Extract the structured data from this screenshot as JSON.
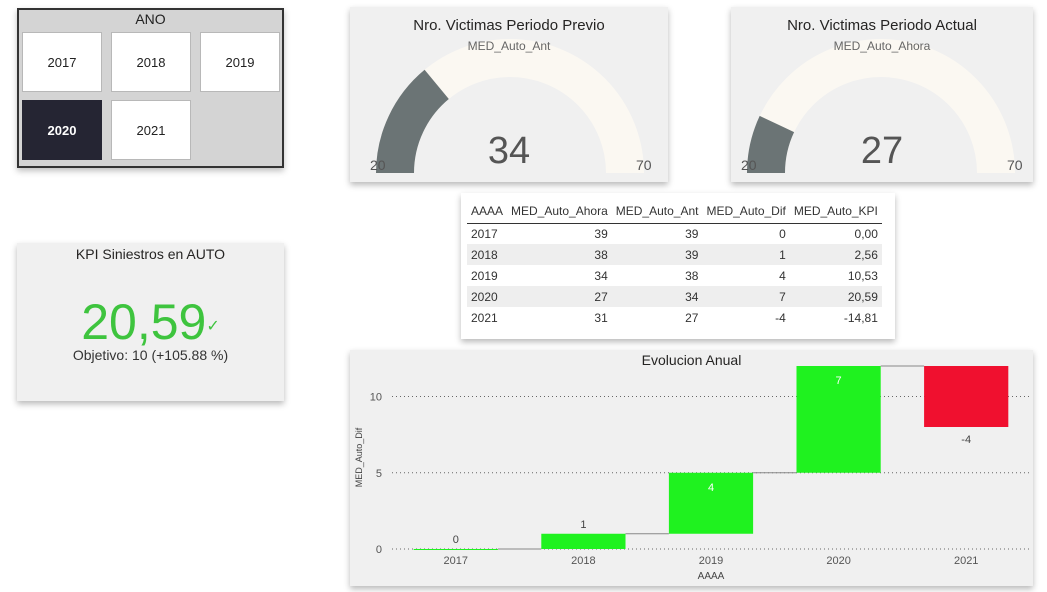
{
  "slicer": {
    "title": "ANO",
    "items": [
      {
        "label": "2017",
        "selected": false
      },
      {
        "label": "2018",
        "selected": false
      },
      {
        "label": "2019",
        "selected": false
      },
      {
        "label": "2020",
        "selected": true
      },
      {
        "label": "2021",
        "selected": false
      }
    ]
  },
  "gauge_prev": {
    "title": "Nro. Victimas Periodo Previo",
    "subtitle": "MED_Auto_Ant",
    "min": 20,
    "max": 70,
    "value": 34,
    "min_label": "20",
    "max_label": "70",
    "value_label": "34"
  },
  "gauge_curr": {
    "title": "Nro. Victimas Periodo Actual",
    "subtitle": "MED_Auto_Ahora",
    "min": 20,
    "max": 70,
    "value": 27,
    "min_label": "20",
    "max_label": "70",
    "value_label": "27"
  },
  "colors": {
    "gauge_fill": "#6b7475",
    "gauge_track": "#fbf8f2",
    "increase": "#1ff21f",
    "decrease": "#f0102f",
    "kpi_good": "#3ec43e",
    "slicer_selected": "#252533"
  },
  "table": {
    "headers": [
      "AAAA",
      "MED_Auto_Ahora",
      "MED_Auto_Ant",
      "MED_Auto_Dif",
      "MED_Auto_KPI"
    ],
    "rows": [
      [
        "2017",
        "39",
        "39",
        "0",
        "0,00"
      ],
      [
        "2018",
        "38",
        "39",
        "1",
        "2,56"
      ],
      [
        "2019",
        "34",
        "38",
        "4",
        "10,53"
      ],
      [
        "2020",
        "27",
        "34",
        "7",
        "20,59"
      ],
      [
        "2021",
        "31",
        "27",
        "-4",
        "-14,81"
      ]
    ]
  },
  "kpi": {
    "title": "KPI Siniestros en AUTO",
    "value": "20,59",
    "check_icon": "checkmark-icon",
    "goal": "Objetivo: 10 (+105.88 %)"
  },
  "chart_data": {
    "type": "bar",
    "subtype": "waterfall",
    "title": "Evolucion Anual",
    "xlabel": "AAAA",
    "ylabel": "MED_Auto_Dif",
    "categories": [
      "2017",
      "2018",
      "2019",
      "2020",
      "2021"
    ],
    "values": [
      0,
      1,
      4,
      7,
      -4
    ],
    "data_labels": [
      "0",
      "1",
      "4",
      "7",
      "-4"
    ],
    "yticks": [
      0,
      5,
      10
    ],
    "ylim": [
      0,
      12
    ],
    "grid": true
  }
}
